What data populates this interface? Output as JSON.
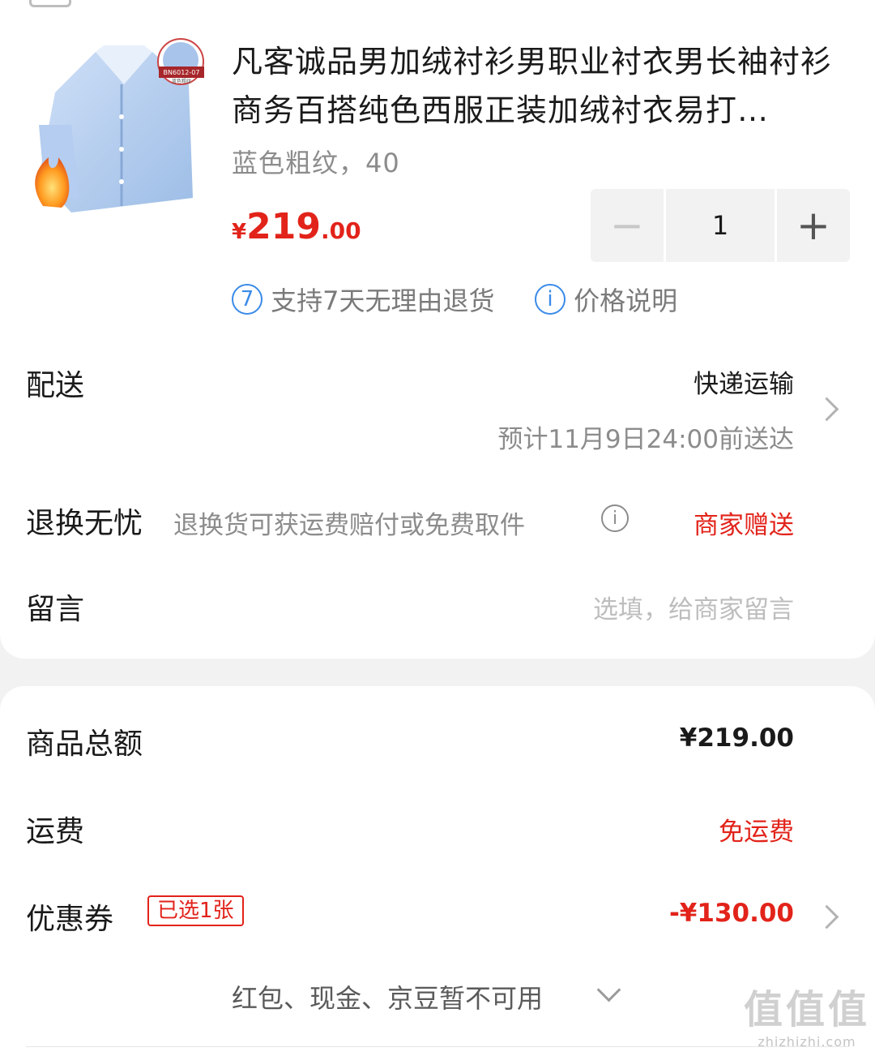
{
  "product": {
    "title": "凡客诚品男加绒衬衫男职业衬衣男长袖衬衫商务百搭纯色西服正装加绒衬衣易打…",
    "spec": "蓝色粗纹，40",
    "price_currency": "¥",
    "price_int": "219",
    "price_dec": ".00",
    "quantity": "1",
    "image_tag": "BN6012-07",
    "image_tag_sub": "蓝色粗纹"
  },
  "services": {
    "return_badge": "7",
    "return_text": "支持7天无理由退货",
    "price_badge": "i",
    "price_text": "价格说明"
  },
  "delivery": {
    "label": "配送",
    "method": "快递运输",
    "eta": "预计11月9日24:00前送达"
  },
  "returns": {
    "label": "退换无忧",
    "desc": "退换货可获运费赔付或免费取件",
    "value": "商家赠送"
  },
  "message": {
    "label": "留言",
    "placeholder": "选填，给商家留言"
  },
  "summary": {
    "subtotal_label": "商品总额",
    "subtotal_value": "¥219.00",
    "shipping_label": "运费",
    "shipping_value": "免运费",
    "coupon_label": "优惠券",
    "coupon_tag": "已选1张",
    "coupon_value": "-¥130.00",
    "unavailable_text": "红包、现金、京豆暂不可用"
  },
  "watermark": {
    "big": "值值值",
    "small": "zhizhizhi.com"
  },
  "colors": {
    "accent_red": "#e2231a",
    "badge_blue": "#3a8be8",
    "background": "#f2f2f2"
  }
}
